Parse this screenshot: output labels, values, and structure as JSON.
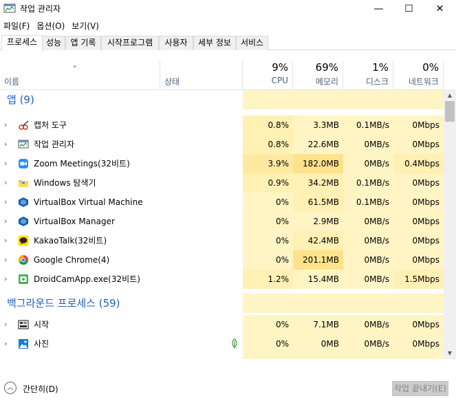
{
  "window": {
    "title": "작업 관리자",
    "minimize_glyph": "—",
    "maximize_glyph": "☐",
    "close_glyph": "✕"
  },
  "menu": [
    "파일(F)",
    "옵션(O)",
    "보기(V)"
  ],
  "tabs": [
    "프로세스",
    "성능",
    "앱 기록",
    "시작프로그램",
    "사용자",
    "세부 정보",
    "서비스"
  ],
  "active_tab": "프로세스",
  "columns": {
    "name": "이름",
    "status": "상태",
    "cpu": {
      "percent": "9%",
      "label": "CPU"
    },
    "memory": {
      "percent": "69%",
      "label": "메모리"
    },
    "disk": {
      "percent": "1%",
      "label": "디스크"
    },
    "network": {
      "percent": "0%",
      "label": "네트워크"
    }
  },
  "groups": {
    "apps": {
      "title": "앱 (9)",
      "items": [
        {
          "name": "캡처 도구",
          "icon": "snipping-tool-icon",
          "cpu": "0.8%",
          "mem": "3.3MB",
          "disk": "0.1MB/s",
          "net": "0Mbps"
        },
        {
          "name": "작업 관리자",
          "icon": "task-manager-icon",
          "cpu": "0.8%",
          "mem": "22.6MB",
          "disk": "0MB/s",
          "net": "0Mbps"
        },
        {
          "name": "Zoom Meetings(32비트)",
          "icon": "zoom-icon",
          "cpu": "3.9%",
          "mem": "182.0MB",
          "disk": "0MB/s",
          "net": "0.4Mbps"
        },
        {
          "name": "Windows 탐색기",
          "icon": "file-explorer-icon",
          "cpu": "0.9%",
          "mem": "34.2MB",
          "disk": "0.1MB/s",
          "net": "0Mbps"
        },
        {
          "name": "VirtualBox Virtual Machine",
          "icon": "virtualbox-icon",
          "cpu": "0%",
          "mem": "61.5MB",
          "disk": "0.1MB/s",
          "net": "0Mbps"
        },
        {
          "name": "VirtualBox Manager",
          "icon": "virtualbox-icon",
          "cpu": "0%",
          "mem": "2.9MB",
          "disk": "0MB/s",
          "net": "0Mbps"
        },
        {
          "name": "KakaoTalk(32비트)",
          "icon": "kakaotalk-icon",
          "cpu": "0%",
          "mem": "42.4MB",
          "disk": "0MB/s",
          "net": "0Mbps"
        },
        {
          "name": "Google Chrome(4)",
          "icon": "chrome-icon",
          "cpu": "0%",
          "mem": "201.1MB",
          "disk": "0MB/s",
          "net": "0Mbps"
        },
        {
          "name": "DroidCamApp.exe(32비트)",
          "icon": "droidcam-icon",
          "cpu": "1.2%",
          "mem": "15.4MB",
          "disk": "0MB/s",
          "net": "1.5Mbps"
        }
      ]
    },
    "background": {
      "title": "백그라운드 프로세스 (59)",
      "items": [
        {
          "name": "시작",
          "icon": "start-icon",
          "cpu": "0%",
          "mem": "7.1MB",
          "disk": "0MB/s",
          "net": "0Mbps"
        },
        {
          "name": "사진",
          "icon": "photos-icon",
          "cpu": "0%",
          "mem": "0MB",
          "disk": "0MB/s",
          "net": "0Mbps",
          "suspended": true
        }
      ]
    }
  },
  "footer": {
    "collapse_label": "간단히(D)",
    "end_task_label": "작업 끝내기(E)"
  }
}
